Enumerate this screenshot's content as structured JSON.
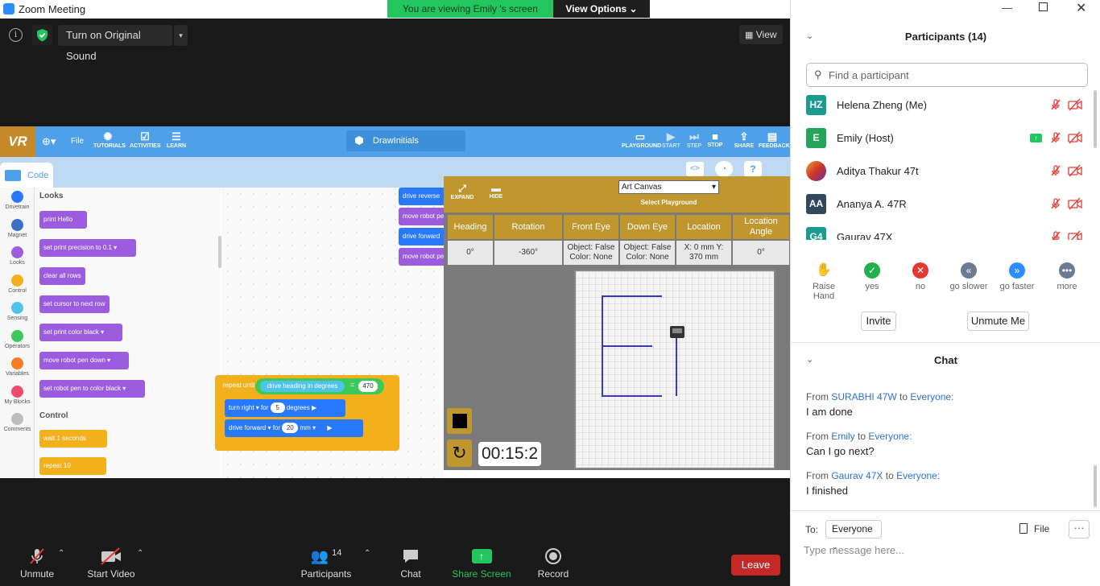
{
  "window": {
    "title": "Zoom Meeting"
  },
  "share_banner": {
    "viewing": "You are viewing Emily 's screen",
    "view_options": "View Options ⌄"
  },
  "top_controls": {
    "sound_button": "Turn on Original Sound",
    "view_button": "View"
  },
  "vr": {
    "logo": "VR",
    "menu": {
      "file": "File",
      "tutorials": "TUTORIALS",
      "activities": "ACTIVITIES",
      "learn": "LEARN"
    },
    "project_name": "DrawInitials",
    "right_tools": [
      "PLAYGROUND",
      "START",
      "STEP",
      "STOP",
      "SHARE",
      "FEEDBACK"
    ],
    "code_tab": "Code",
    "categories": [
      {
        "label": "Drivetrain",
        "color": "#2979ff"
      },
      {
        "label": "Magnet",
        "color": "#3a6fc4"
      },
      {
        "label": "Looks",
        "color": "#9c5ce0"
      },
      {
        "label": "Control",
        "color": "#f2b01c"
      },
      {
        "label": "Sensing",
        "color": "#4fc3e8"
      },
      {
        "label": "Operators",
        "color": "#3cc85a"
      },
      {
        "label": "Variables",
        "color": "#f57c22"
      },
      {
        "label": "My Blocks",
        "color": "#ef4a6a"
      },
      {
        "label": "Comments",
        "color": "#bdbdbd"
      }
    ],
    "palette": {
      "looks_heading": "Looks",
      "control_heading": "Control",
      "blocks": [
        "print Hello",
        "set print precision to  0.1 ▾",
        "clear all rows",
        "set cursor to next row",
        "set print color  black ▾",
        "move robot pen  down ▾",
        "set robot pen to color  black ▾",
        "wait  1  seconds",
        "repeat  10"
      ]
    },
    "workspace": {
      "top_blocks": [
        "drive reverse",
        "move robot pen",
        "drive forward",
        "move robot pen"
      ],
      "repeat_until": "repeat until",
      "condition": "drive heading in degrees",
      "operator": "=",
      "value": "470",
      "turn_block": "turn  right ▾  for",
      "turn_value": "5",
      "turn_unit": "degrees ▶",
      "drive_block": "drive  forward ▾  for",
      "drive_value": "20",
      "drive_unit": "mm ▾"
    },
    "playground": {
      "expand": "EXPAND",
      "hide": "HIDE",
      "select_value": "Art Canvas",
      "select_label": "Select Playground",
      "headers": [
        "Heading",
        "Rotation",
        "Front Eye",
        "Down Eye",
        "Location",
        "Location Angle"
      ],
      "values": [
        "0°",
        "-360°",
        "Object: False Color: None",
        "Object: False Color: None",
        "X: 0 mm Y: 370 mm",
        "0°"
      ],
      "timer": "00:15:2"
    }
  },
  "toolbar": {
    "unmute": "Unmute",
    "start_video": "Start Video",
    "participants": "Participants",
    "participants_count": "14",
    "chat": "Chat",
    "share_screen": "Share Screen",
    "record": "Record",
    "leave": "Leave"
  },
  "participants_panel": {
    "title": "Participants (14)",
    "search_placeholder": "Find a participant",
    "people": [
      {
        "initials": "HZ",
        "name": "Helena Zheng (Me)",
        "color": "#1a9b8f"
      },
      {
        "initials": "E",
        "name": "Emily  (Host)",
        "color": "#27a35c"
      },
      {
        "initials": "",
        "name": "Aditya Thakur 47t",
        "color": "#e0572a"
      },
      {
        "initials": "AA",
        "name": "Ananya A.  47R",
        "color": "#33485e"
      },
      {
        "initials": "G4",
        "name": "Gaurav 47X",
        "color": "#1a9b8f"
      }
    ],
    "reactions": [
      {
        "label": "Raise Hand",
        "color": "#2d8cff",
        "glyph": "✋"
      },
      {
        "label": "yes",
        "color": "#22b14c",
        "glyph": "✓"
      },
      {
        "label": "no",
        "color": "#e53935",
        "glyph": "✕"
      },
      {
        "label": "go slower",
        "color": "#6b7b93",
        "glyph": "«"
      },
      {
        "label": "go faster",
        "color": "#2d8cff",
        "glyph": "»"
      },
      {
        "label": "more",
        "color": "#6b7b93",
        "glyph": "•••"
      }
    ],
    "invite": "Invite",
    "unmute_me": "Unmute Me"
  },
  "chat_panel": {
    "title": "Chat",
    "from_word": "From",
    "to_word": "to",
    "messages": [
      {
        "sender": "SURABHI 47W",
        "to": "Everyone:",
        "text": "I am done"
      },
      {
        "sender": "Emily",
        "to": "Everyone:",
        "text": "Can I go next?"
      },
      {
        "sender": "Gaurav 47X",
        "to": "Everyone:",
        "text": "I finished"
      }
    ],
    "to_label": "To:",
    "recipient": "Everyone",
    "file": "File",
    "input_placeholder": "Type message here..."
  }
}
